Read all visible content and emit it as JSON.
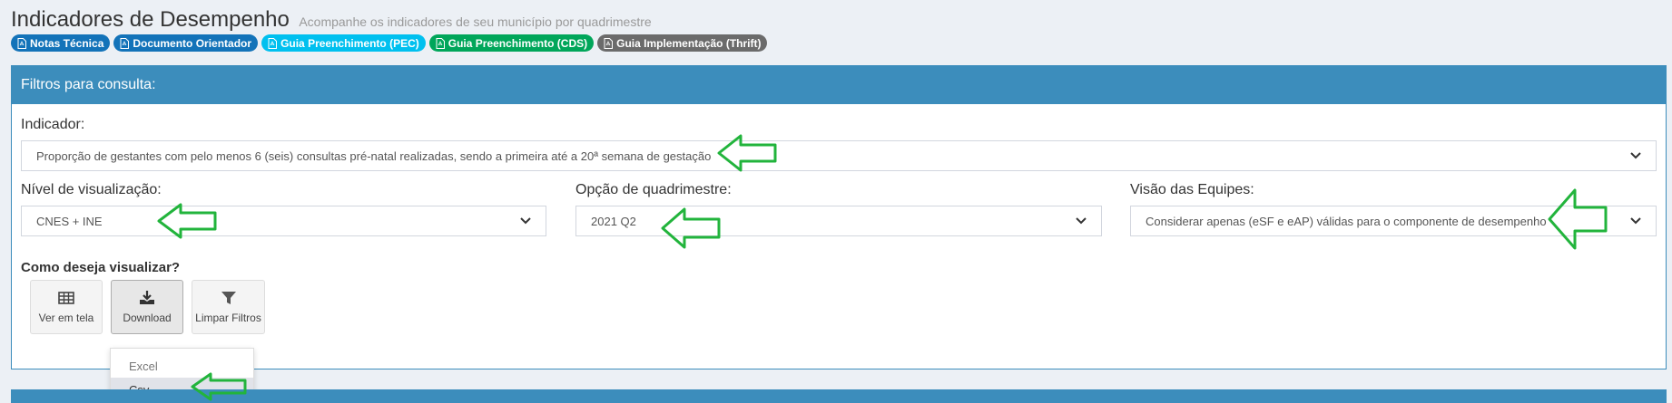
{
  "header": {
    "title": "Indicadores de Desempenho",
    "subtitle": "Acompanhe os indicadores de seu município por quadrimestre"
  },
  "badges": [
    {
      "label": "Notas Técnica",
      "color": "#1373b9"
    },
    {
      "label": "Documento Orientador",
      "color": "#1373b9"
    },
    {
      "label": "Guia Preenchimento (PEC)",
      "color": "#00c0ef"
    },
    {
      "label": "Guia Preenchimento (CDS)",
      "color": "#00a65a"
    },
    {
      "label": "Guia Implementação (Thrift)",
      "color": "#6b6b6b"
    }
  ],
  "filters": {
    "title": "Filtros para consulta:",
    "indicador": {
      "label": "Indicador:",
      "value": "Proporção de gestantes com pelo menos 6 (seis) consultas pré-natal realizadas, sendo a primeira até a 20ª semana de gestação"
    },
    "nivel": {
      "label": "Nível de visualização:",
      "value": "CNES + INE"
    },
    "quadrimestre": {
      "label": "Opção de quadrimestre:",
      "value": "2021 Q2"
    },
    "equipes": {
      "label": "Visão das Equipes:",
      "value": "Considerar apenas (eSF e eAP) válidas para o componente de desempenho"
    }
  },
  "view": {
    "title": "Como deseja visualizar?",
    "buttons": [
      {
        "label": "Ver em tela",
        "icon": "table-icon"
      },
      {
        "label": "Download",
        "icon": "download-icon"
      },
      {
        "label": "Limpar Filtros",
        "icon": "filter-icon"
      }
    ],
    "download_menu": [
      "Excel",
      "Csv"
    ]
  },
  "colors": {
    "primary": "#3c8dbc",
    "arrow": "#22b43c"
  }
}
